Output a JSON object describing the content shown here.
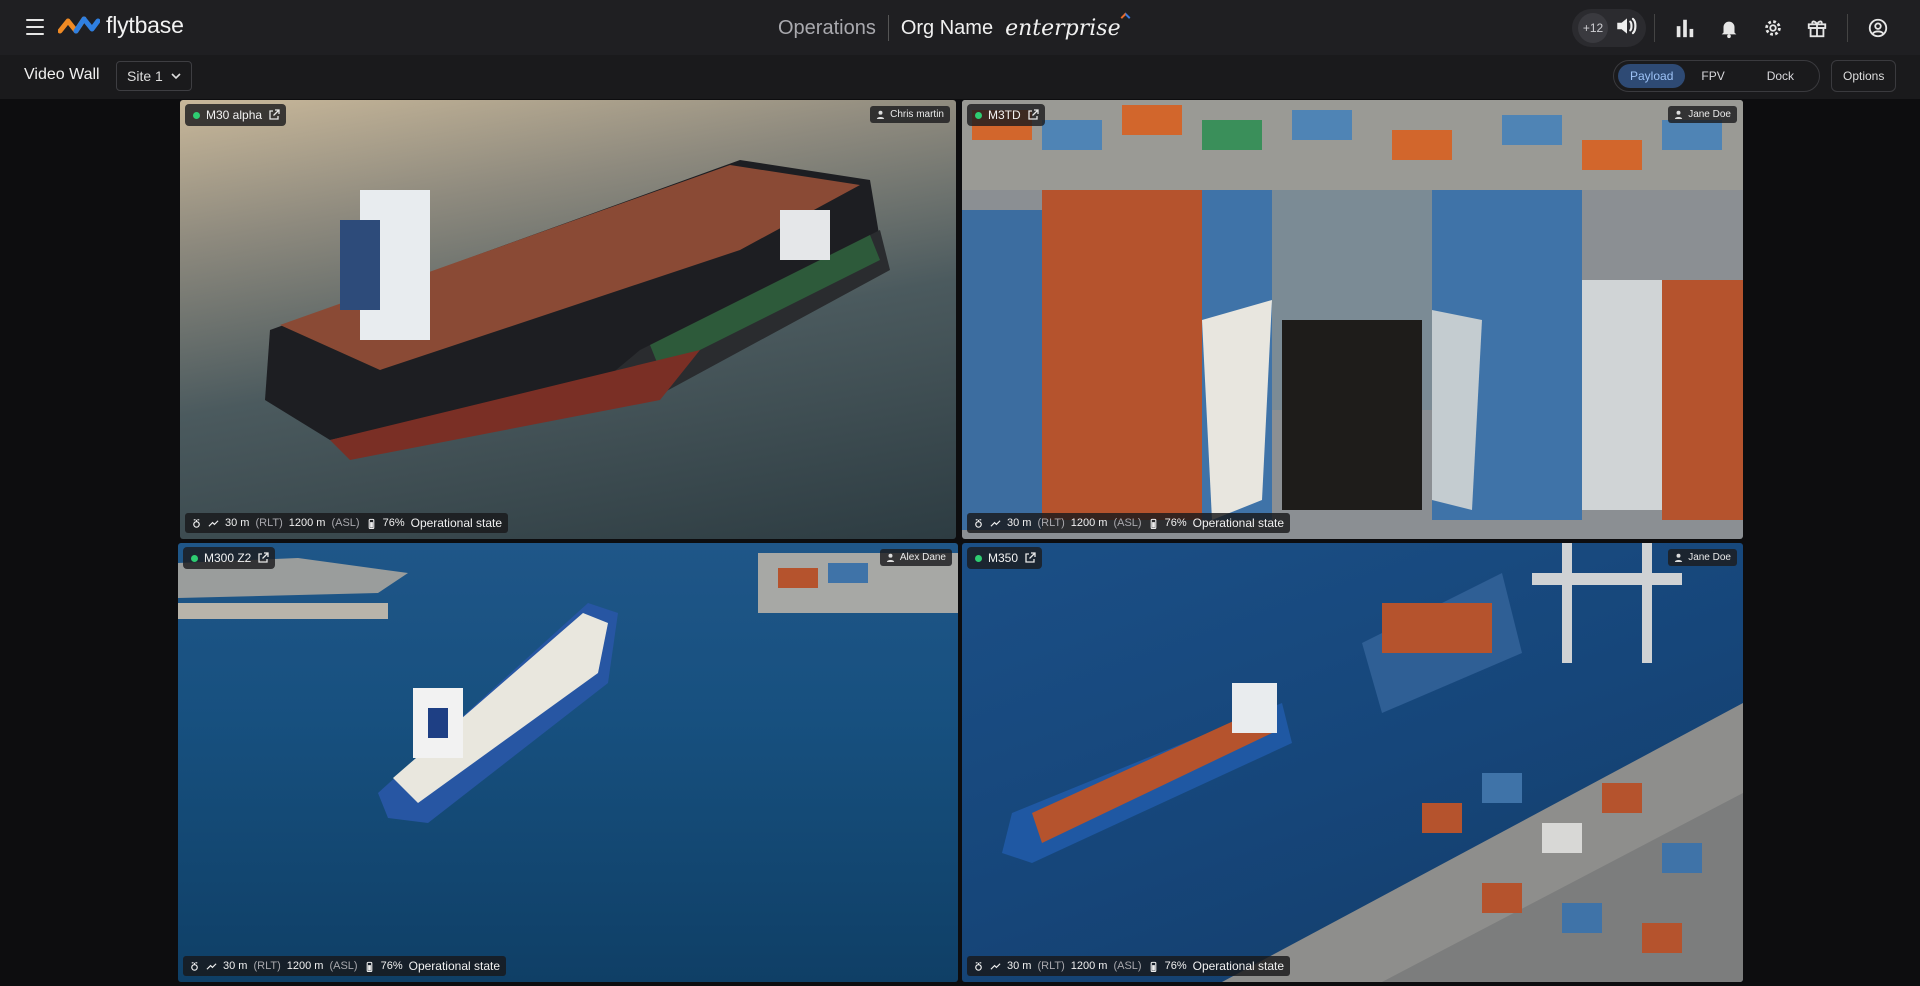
{
  "app": {
    "brand": "flytbase",
    "section": "Operations",
    "org_name": "Org Name",
    "edition": "enterprise"
  },
  "toolbar": {
    "notifications_count": "+12",
    "icons": [
      "volume-icon",
      "analytics-icon",
      "bell-icon",
      "gear-icon",
      "gift-icon",
      "user-icon"
    ]
  },
  "subbar": {
    "title": "Video Wall",
    "site_selected": "Site 1",
    "view_modes": [
      "Payload",
      "FPV",
      "Dock"
    ],
    "active_mode": "Payload",
    "options_label": "Options"
  },
  "tiles": [
    {
      "drone": "M30 alpha",
      "operator": "Chris martin",
      "status": {
        "rlt_value": "30 m",
        "rlt_unit": "(RLT)",
        "asl_value": "1200 m",
        "asl_unit": "(ASL)",
        "battery": "76%",
        "state": "Operational state"
      }
    },
    {
      "drone": "M3TD",
      "operator": "Jane Doe",
      "status": {
        "rlt_value": "30 m",
        "rlt_unit": "(RLT)",
        "asl_value": "1200 m",
        "asl_unit": "(ASL)",
        "battery": "76%",
        "state": "Operational state"
      }
    },
    {
      "drone": "M300 Z2",
      "operator": "Alex Dane",
      "status": {
        "rlt_value": "30 m",
        "rlt_unit": "(RLT)",
        "asl_value": "1200 m",
        "asl_unit": "(ASL)",
        "battery": "76%",
        "state": "Operational state"
      }
    },
    {
      "drone": "M350",
      "operator": "Jane Doe",
      "status": {
        "rlt_value": "30 m",
        "rlt_unit": "(RLT)",
        "asl_value": "1200 m",
        "asl_unit": "(ASL)",
        "battery": "76%",
        "state": "Operational state"
      }
    }
  ],
  "colors": {
    "online": "#2ecc71",
    "accent": "#2e4a74",
    "accent_text": "#9cc1f5"
  }
}
